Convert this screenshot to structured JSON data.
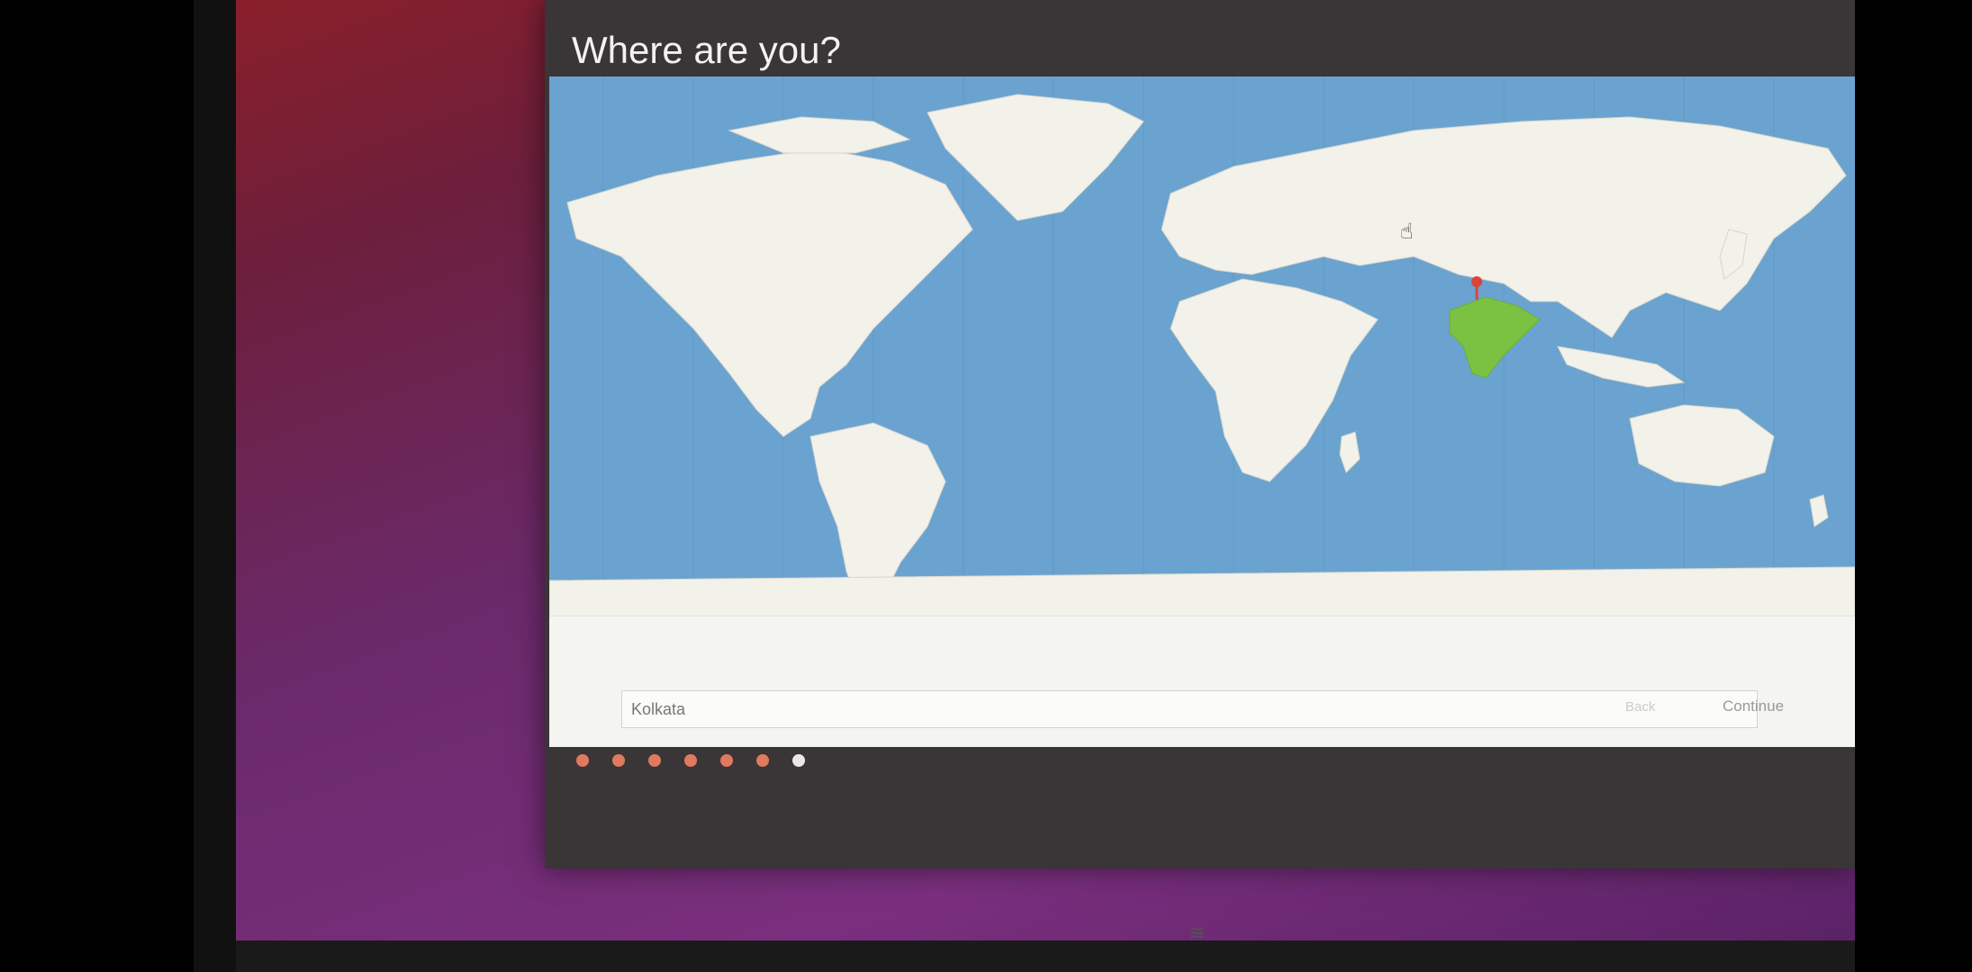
{
  "window": {
    "title": "Where are you?"
  },
  "location": {
    "value": "Kolkata",
    "selected_region": "India"
  },
  "buttons": {
    "back_label": "Back",
    "continue_label": "Continue"
  },
  "progress": {
    "total_steps": 7,
    "current_step": 7
  },
  "colors": {
    "ocean": "#6aa3cf",
    "land": "#f2f1ea",
    "selected_region": "#7cc242",
    "pin": "#d9453a",
    "dot_inactive": "#e07a5f",
    "dot_active": "#e8e8e8"
  }
}
